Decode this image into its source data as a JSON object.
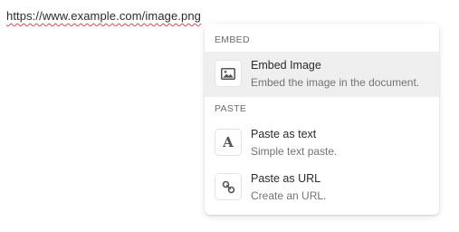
{
  "editor": {
    "text": "https://www.example.com/image.png"
  },
  "menu": {
    "sections": [
      {
        "label": "EMBED",
        "items": [
          {
            "title": "Embed Image",
            "description": "Embed the image in the document.",
            "icon": "image-icon",
            "active": true
          }
        ]
      },
      {
        "label": "PASTE",
        "items": [
          {
            "title": "Paste as text",
            "description": "Simple text paste.",
            "icon": "text-a-icon"
          },
          {
            "title": "Paste as URL",
            "description": "Create an URL.",
            "icon": "link-icon"
          }
        ]
      }
    ]
  }
}
